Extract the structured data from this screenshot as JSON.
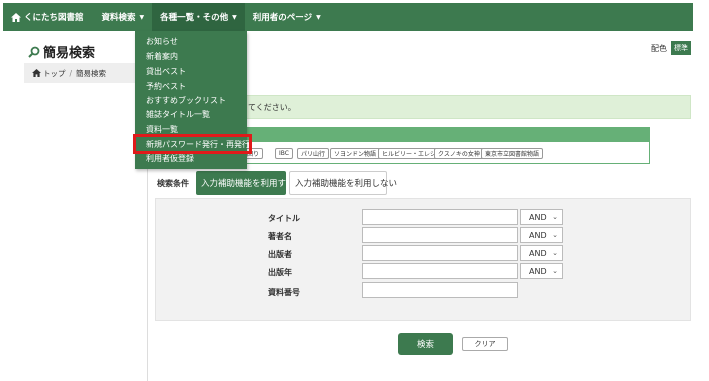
{
  "navbar": {
    "brand": "くにたち図書館",
    "items": [
      {
        "label": "資料検索"
      },
      {
        "label": "各種一覧・その他"
      },
      {
        "label": "利用者のページ"
      }
    ]
  },
  "page": {
    "title": "簡易検索"
  },
  "color_setting": {
    "label": "配色",
    "value": "標準"
  },
  "breadcrumb": {
    "home": "トップ",
    "current": "簡易検索"
  },
  "notice": {
    "text": "てください。"
  },
  "tags": [
    "回り",
    "IBC",
    "パリ山行",
    "ソヨンドン物語",
    "ヒルビリー・エレジー",
    "クスノキの女神",
    "東京市立図書館物語"
  ],
  "search": {
    "condition_label": "検索条件",
    "mode_assist_on": "入力補助機能を利用する",
    "mode_assist_off": "入力補助機能を利用しない",
    "fields": [
      {
        "label": "タイトル",
        "value": "",
        "operator": "AND"
      },
      {
        "label": "著者名",
        "value": "",
        "operator": "AND"
      },
      {
        "label": "出版者",
        "value": "",
        "operator": "AND"
      },
      {
        "label": "出版年",
        "value": "",
        "operator": "AND"
      },
      {
        "label": "資料番号",
        "value": ""
      }
    ],
    "search_button": "検索",
    "clear_button": "クリア"
  },
  "dropdown": {
    "items": [
      "お知らせ",
      "新着案内",
      "貸出ベスト",
      "予約ベスト",
      "おすすめブックリスト",
      "雑誌タイトル一覧",
      "資料一覧",
      "新規パスワード発行・再発行",
      "利用者仮登録"
    ],
    "highlighted_index": 7
  },
  "colors": {
    "primary": "#3d7a4f",
    "tag_header": "#66b077",
    "notice_bg": "#dff0d8",
    "highlight": "#e01a1a"
  }
}
